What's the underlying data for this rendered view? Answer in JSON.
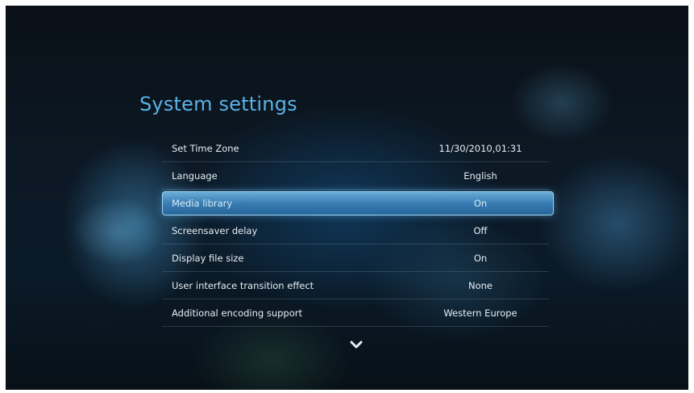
{
  "page": {
    "title": "System settings"
  },
  "settings": [
    {
      "label": "Set Time Zone",
      "value": "11/30/2010,01:31",
      "selected": false
    },
    {
      "label": "Language",
      "value": "English",
      "selected": false
    },
    {
      "label": "Media library",
      "value": "On",
      "selected": true
    },
    {
      "label": "Screensaver delay",
      "value": "Off",
      "selected": false
    },
    {
      "label": "Display file size",
      "value": "On",
      "selected": false
    },
    {
      "label": "User interface transition effect",
      "value": "None",
      "selected": false
    },
    {
      "label": "Additional encoding support",
      "value": "Western Europe",
      "selected": false
    }
  ],
  "icons": {
    "scroll_down": "chevron-down-icon"
  },
  "colors": {
    "title": "#5ab3e6",
    "highlight": "#4f9ed6",
    "text": "#e6eef4"
  }
}
